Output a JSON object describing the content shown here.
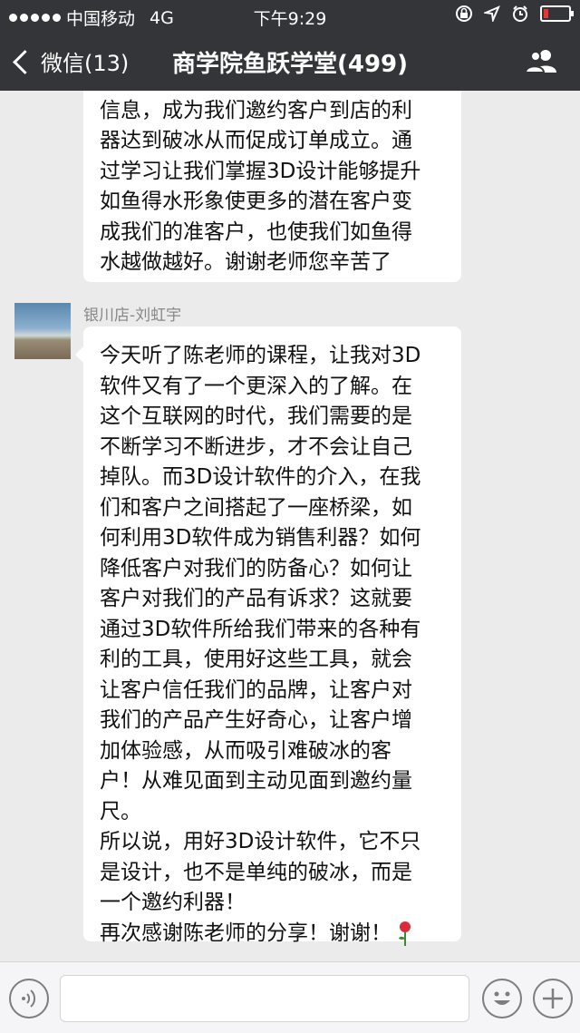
{
  "status_bar": {
    "carrier": "中国移动",
    "network": "4G",
    "time": "下午9:29",
    "icons": [
      "signal-dots-icon",
      "lock-rotation-icon",
      "location-icon",
      "alarm-icon",
      "battery-icon"
    ],
    "battery_level": 0.15
  },
  "nav": {
    "back_label": "微信(13)",
    "title": "商学院鱼跃学堂(499)",
    "icons": [
      "chevron-left-icon",
      "group-members-icon"
    ]
  },
  "messages": [
    {
      "lines": [
        "信息，成为我们邀约客户到店的利",
        "器达到破冰从而促成订单成立。通",
        "过学习让我们掌握3D设计能够提升",
        "如鱼得水形象使更多的潜在客户变",
        "成我们的准客户，也使我们如鱼得",
        "水越做越好。谢谢老师您辛苦了"
      ]
    },
    {
      "sender": "银川店-刘虹宇",
      "lines": [
        "今天听了陈老师的课程，让我对3D",
        "软件又有了一个更深入的了解。在",
        "这个互联网的时代，我们需要的是",
        "不断学习不断进步，才不会让自己",
        "掉队。而3D设计软件的介入，在我",
        "们和客户之间搭起了一座桥梁，如",
        "何利用3D软件成为销售利器？如何",
        "降低客户对我们的防备心？如何让",
        "客户对我们的产品有诉求？这就要",
        "通过3D软件所给我们带来的各种有",
        "利的工具，使用好这些工具，就会",
        "让客户信任我们的品牌，让客户对",
        "我们的产品产生好奇心，让客户增",
        "加体验感，从而吸引难破冰的客",
        "户！从难见面到主动见面到邀约量",
        "尺。",
        "所以说，用好3D设计软件，它不只",
        "是设计，也不是单纯的破冰，而是",
        "一个邀约利器！",
        "再次感谢陈老师的分享！谢谢！"
      ],
      "emoji": [
        "rose-icon",
        "rose-icon",
        "rose-icon"
      ]
    }
  ],
  "input_bar": {
    "icons": [
      "voice-icon",
      "emoji-icon",
      "plus-icon"
    ],
    "text": ""
  },
  "colors": {
    "bar": "#333538",
    "chat_bg": "#ebebeb",
    "bubble": "#ffffff",
    "battery_low": "#e33333"
  }
}
